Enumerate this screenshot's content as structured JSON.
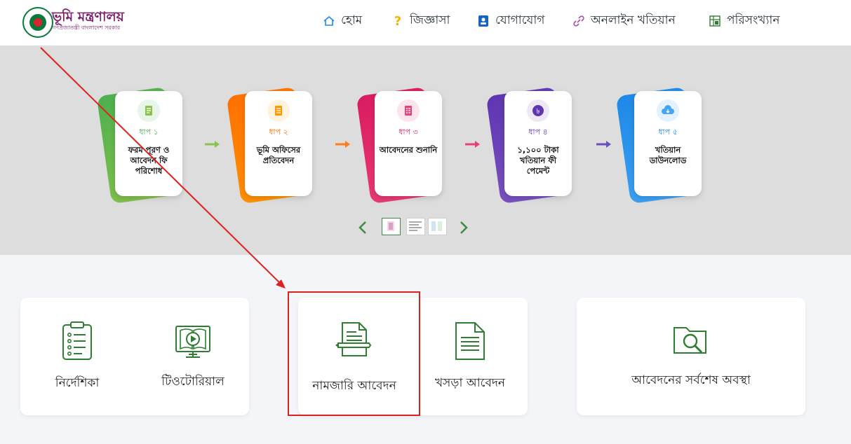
{
  "brand": {
    "title": "ভূমি মন্ত্রণালয়",
    "subtitle": "গণপ্রজাতন্ত্রী বাংলাদেশ সরকার"
  },
  "nav": {
    "items": [
      {
        "label": "হোম",
        "icon": "home-icon"
      },
      {
        "label": "জিজ্ঞাসা",
        "icon": "question-icon"
      },
      {
        "label": "যোগাযোগ",
        "icon": "contact-book-icon"
      },
      {
        "label": "অনলাইন খতিয়ান",
        "icon": "link-icon"
      },
      {
        "label": "পরিসংখ্যান",
        "icon": "statistics-icon"
      }
    ]
  },
  "steps": [
    {
      "step": "ধাপ ১",
      "text": "ফরম পূরণ ও আবেদন ফি পরিশোধ",
      "color": "#4caf50",
      "color2": "#8bc34a"
    },
    {
      "step": "ধাপ ২",
      "text": "ভূমি অফিসের প্রতিবেদন",
      "color": "#ff6f00",
      "color2": "#ff9800"
    },
    {
      "step": "ধাপ ৩",
      "text": "আবেদনের শুনানি",
      "color": "#d81b60",
      "color2": "#ec407a"
    },
    {
      "step": "ধাপ ৪",
      "text": "১,১০০ টাকা খতিয়ান ফী পেমেন্ট",
      "color": "#5e35b1",
      "color2": "#7e57c2"
    },
    {
      "step": "ধাপ ৫",
      "text": "খতিয়ান ডাউনলোড",
      "color": "#1e88e5",
      "color2": "#42a5f5"
    }
  ],
  "arrow_colors": [
    "#8bc34a",
    "#ff7a1a",
    "#e6407a",
    "#6a4fb8"
  ],
  "tiles": {
    "guide": "নির্দেশিকা",
    "tutorial": "টিওটোরিয়াল",
    "namjari": "নামজারি আবেদন",
    "khosra": "খসড়া আবেদন",
    "status": "আবেদনের সর্বশেষ অবস্থা"
  },
  "colors": {
    "accent": "#3d8b40",
    "highlight": "#e02020",
    "brand": "#7a1f6d"
  }
}
